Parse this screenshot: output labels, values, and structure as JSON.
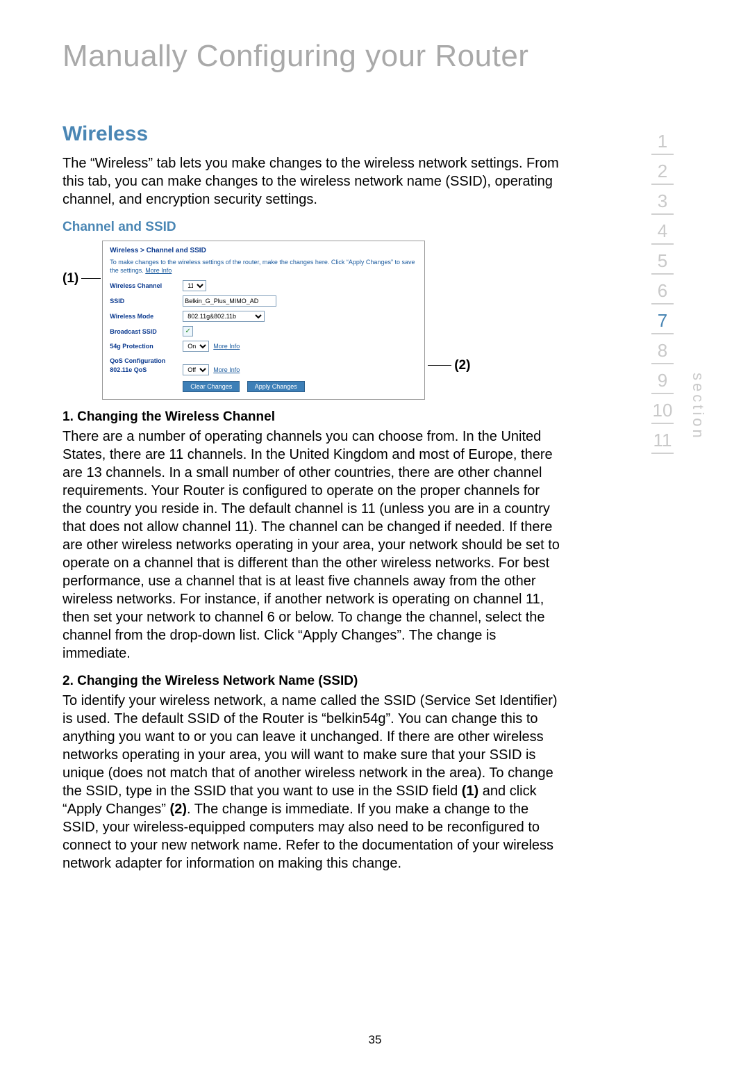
{
  "title": "Manually Configuring your Router",
  "page_number": "35",
  "section_label": "section",
  "section_nav": [
    {
      "n": "1",
      "active": false
    },
    {
      "n": "2",
      "active": false
    },
    {
      "n": "3",
      "active": false
    },
    {
      "n": "4",
      "active": false
    },
    {
      "n": "5",
      "active": false
    },
    {
      "n": "6",
      "active": false
    },
    {
      "n": "7",
      "active": true
    },
    {
      "n": "8",
      "active": false
    },
    {
      "n": "9",
      "active": false
    },
    {
      "n": "10",
      "active": false
    },
    {
      "n": "11",
      "active": false
    }
  ],
  "callouts": {
    "one": "(1)",
    "two": "(2)"
  },
  "headings": {
    "wireless": "Wireless",
    "channel_ssid": "Channel and SSID",
    "sub1": "1. Changing the Wireless Channel",
    "sub2": "2. Changing the Wireless Network Name (SSID)"
  },
  "body": {
    "intro": "The “Wireless” tab lets you make changes to the wireless network settings. From this tab, you can make changes to the wireless network name (SSID), operating channel, and encryption security settings.",
    "p1": "There are a number of operating channels you can choose from. In the United States, there are 11 channels. In the United Kingdom and most of Europe, there are 13 channels. In a small number of other countries, there are other channel requirements. Your Router is configured to operate on the proper channels for the country you reside in. The default channel is 11 (unless you are in a country that does not allow channel 11). The channel can be changed if needed. If there are other wireless networks operating in your area, your network should be set to operate on a channel that is different than the other wireless networks. For best performance, use a channel that is at least five channels away from the other wireless networks. For instance, if another network is operating on channel 11, then set your network to channel 6 or below. To change the channel, select the channel from the drop-down list. Click “Apply Changes”. The change is immediate.",
    "p2_a": "To identify your wireless network, a name called the SSID (Service Set Identifier) is used. The default SSID of the Router is “belkin54g”. You can change this to anything you want to or you can leave it unchanged. If there are other wireless networks operating in your area, you will want to make sure that your SSID is unique (does not match that of another wireless network in the area). To change the SSID, type in the SSID that you want to use in the SSID field ",
    "p2_b": " and click “Apply Changes” ",
    "p2_c": ". The change is immediate. If you make a change to the SSID, your wireless-equipped computers may also need to be reconfigured to connect to your new network name. Refer to the documentation of your wireless network adapter for information on making this change.",
    "p2_ref1": "(1)",
    "p2_ref2": "(2)"
  },
  "figure": {
    "path": "Wireless > Channel and SSID",
    "desc": "To make changes to the wireless settings of the router, make the changes here. Click “Apply Changes” to save the settings. ",
    "more_info": "More Info",
    "labels": {
      "wireless_channel": "Wireless Channel",
      "ssid": "SSID",
      "wireless_mode": "Wireless Mode",
      "broadcast_ssid": "Broadcast SSID",
      "protection": "54g Protection",
      "qos_head": "QoS Configuration",
      "qos": "802.11e QoS"
    },
    "values": {
      "wireless_channel": "11",
      "ssid": "Belkin_G_Plus_MIMO_AD",
      "wireless_mode": "802.11g&802.11b",
      "broadcast_ssid_checked": "✓",
      "protection": "On",
      "qos": "Off"
    },
    "buttons": {
      "clear": "Clear Changes",
      "apply": "Apply Changes"
    }
  }
}
